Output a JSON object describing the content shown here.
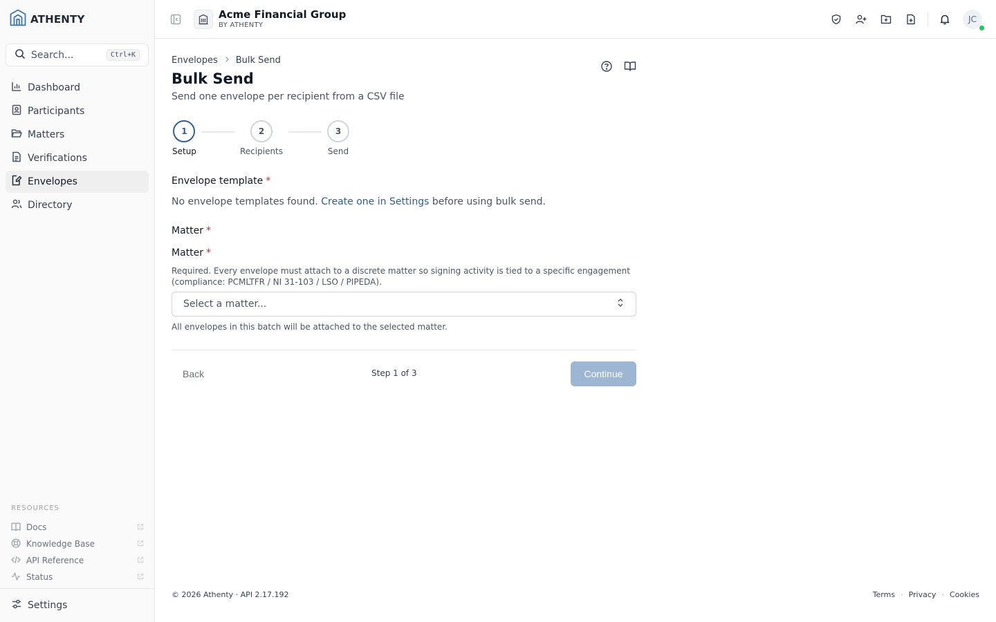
{
  "brand": {
    "name": "ATHENTY"
  },
  "search": {
    "placeholder": "Search...",
    "shortcut": "Ctrl+K"
  },
  "sidebar": {
    "items": [
      {
        "label": "Dashboard",
        "icon": "chart-bar-icon"
      },
      {
        "label": "Participants",
        "icon": "contact-card-icon"
      },
      {
        "label": "Matters",
        "icon": "folder-open-icon"
      },
      {
        "label": "Verifications",
        "icon": "document-icon"
      },
      {
        "label": "Envelopes",
        "icon": "document-edit-icon",
        "active": true
      },
      {
        "label": "Directory",
        "icon": "users-icon"
      }
    ],
    "resources_title": "RESOURCES",
    "resources": [
      {
        "label": "Docs",
        "icon": "book-icon"
      },
      {
        "label": "Knowledge Base",
        "icon": "lifebuoy-icon"
      },
      {
        "label": "API Reference",
        "icon": "code-icon"
      },
      {
        "label": "Status",
        "icon": "activity-icon"
      }
    ],
    "settings_label": "Settings"
  },
  "topbar": {
    "org_name": "Acme Financial Group",
    "org_sub": "BY ATHENTY",
    "avatar_initials": "JC"
  },
  "breadcrumb": {
    "parent": "Envelopes",
    "current": "Bulk Send"
  },
  "page": {
    "title": "Bulk Send",
    "subtitle": "Send one envelope per recipient from a CSV file"
  },
  "stepper": {
    "steps": [
      {
        "number": "1",
        "label": "Setup"
      },
      {
        "number": "2",
        "label": "Recipients"
      },
      {
        "number": "3",
        "label": "Send"
      }
    ]
  },
  "form": {
    "template_label": "Envelope template",
    "required_mark": "*",
    "no_templates_text": "No envelope templates found.",
    "no_templates_link": "Create one in Settings",
    "no_templates_suffix": "before using bulk send.",
    "matter_section_label": "Matter",
    "matter_label": "Matter",
    "matter_help": "Required. Every envelope must attach to a discrete matter so signing activity is tied to a specific engagement (compliance: PCMLTFR / NI 31-103 / LSO / PIPEDA).",
    "matter_placeholder": "Select a matter...",
    "matter_note": "All envelopes in this batch will be attached to the selected matter."
  },
  "nav": {
    "back_label": "Back",
    "step_count": "Step 1 of 3",
    "continue_label": "Continue"
  },
  "footer": {
    "copyright": "© 2026 Athenty · API 2.17.192",
    "links": [
      "Terms",
      "Privacy",
      "Cookies"
    ],
    "separator": "·"
  },
  "colors": {
    "accent": "#2f6096",
    "continue_disabled": "#9db6d3",
    "status_online": "#22c55e",
    "required": "#dc2626"
  }
}
